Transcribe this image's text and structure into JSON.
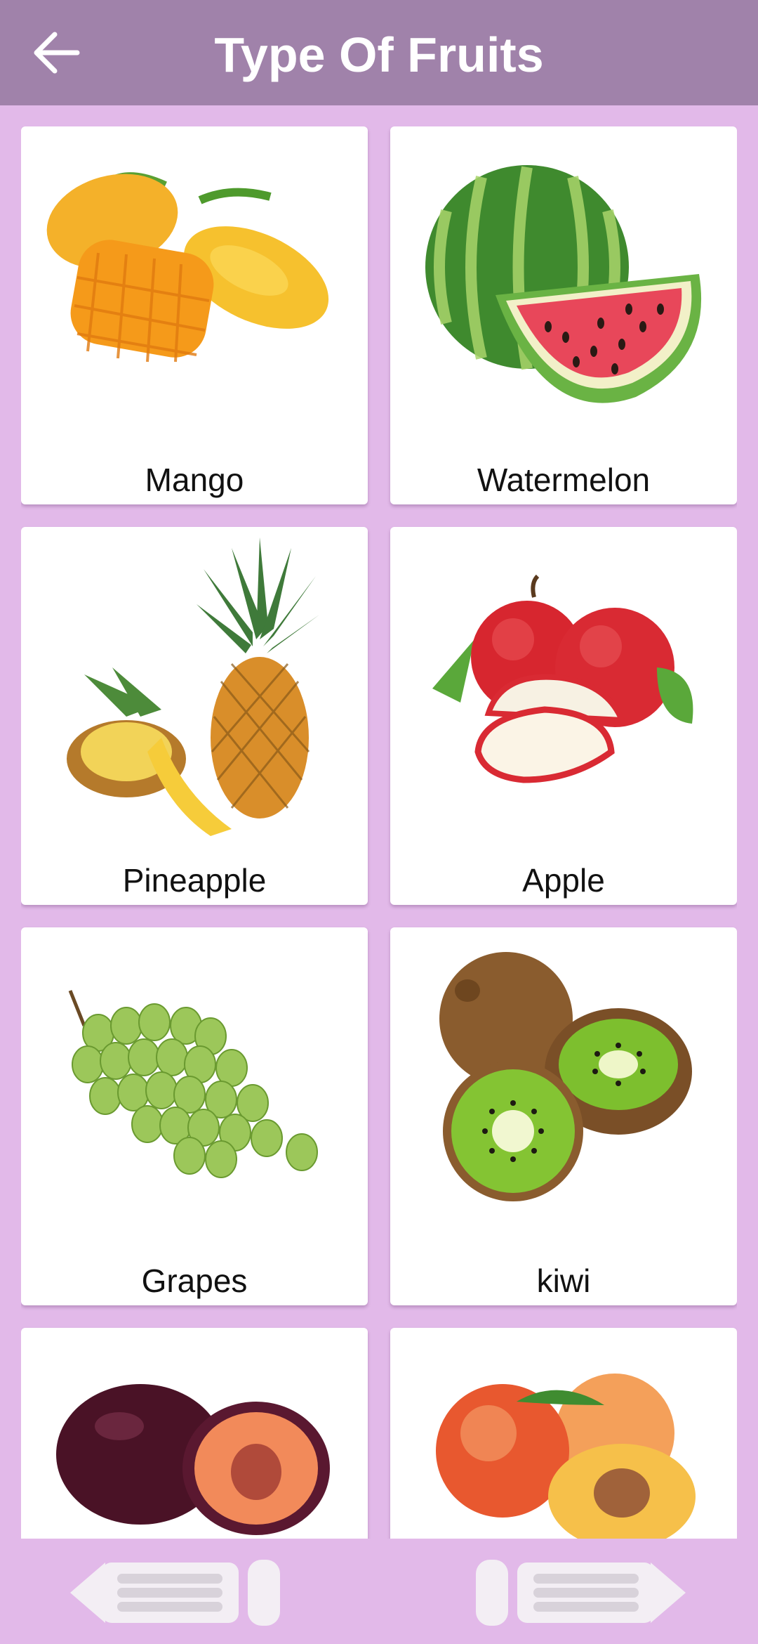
{
  "app_bar": {
    "title": "Type Of Fruits",
    "back_icon": "arrow-left-icon"
  },
  "fruits": [
    {
      "label": "Mango"
    },
    {
      "label": "Watermelon"
    },
    {
      "label": "Pineapple"
    },
    {
      "label": "Apple"
    },
    {
      "label": "Grapes"
    },
    {
      "label": "kiwi"
    },
    {
      "label": ""
    },
    {
      "label": ""
    }
  ],
  "bottom_nav": {
    "previous_icon": "arrow-previous-icon",
    "next_icon": "arrow-next-icon"
  },
  "colors": {
    "app_bar": "#a082aa",
    "background": "#e2b9e9",
    "card": "#ffffff"
  }
}
